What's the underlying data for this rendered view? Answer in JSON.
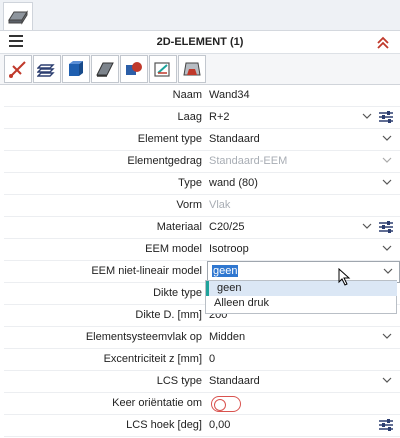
{
  "panel": {
    "title": "2D-ELEMENT (1)",
    "menu_icon": "hamburger-menu-icon",
    "collapse_icon": "double-chevron-up-icon"
  },
  "toolbar_icons": [
    "element-geometry-icon",
    "layers-icon",
    "element-properties-icon",
    "surface-icon",
    "connection-icon",
    "local-axes-icon",
    "support-icon"
  ],
  "properties": [
    {
      "label": "Naam",
      "value": "Wand34"
    },
    {
      "label": "Laag",
      "value": "R+2"
    },
    {
      "label": "Element type",
      "value": "Standaard"
    },
    {
      "label": "Elementgedrag",
      "value": "Standaard-EEM"
    },
    {
      "label": "Type",
      "value": "wand (80)"
    },
    {
      "label": "Vorm",
      "value": "Vlak"
    },
    {
      "label": "Materiaal",
      "value": "C20/25"
    },
    {
      "label": "EEM model",
      "value": "Isotroop"
    },
    {
      "label": "EEM niet-lineair model",
      "value": "geen"
    },
    {
      "label": "Dikte type",
      "value": ""
    },
    {
      "label": "Dikte D. [mm]",
      "value": "200"
    },
    {
      "label": "Elementsysteemvlak op",
      "value": "Midden"
    },
    {
      "label": "Excentriciteit z [mm]",
      "value": "0"
    },
    {
      "label": "LCS type",
      "value": "Standaard"
    },
    {
      "label": "Keer oriëntatie om",
      "value": ""
    },
    {
      "label": "LCS hoek [deg]",
      "value": "0,00"
    }
  ],
  "dropdown": {
    "options": [
      "geen",
      "Alleen druk"
    ],
    "highlighted": "geen"
  },
  "colors": {
    "accent": "#2f77d0",
    "toggle_off": "#d9534f",
    "highlight": "#dbe7f5",
    "highlight_bar": "#1fa39b",
    "collapse": "#c0392b"
  }
}
